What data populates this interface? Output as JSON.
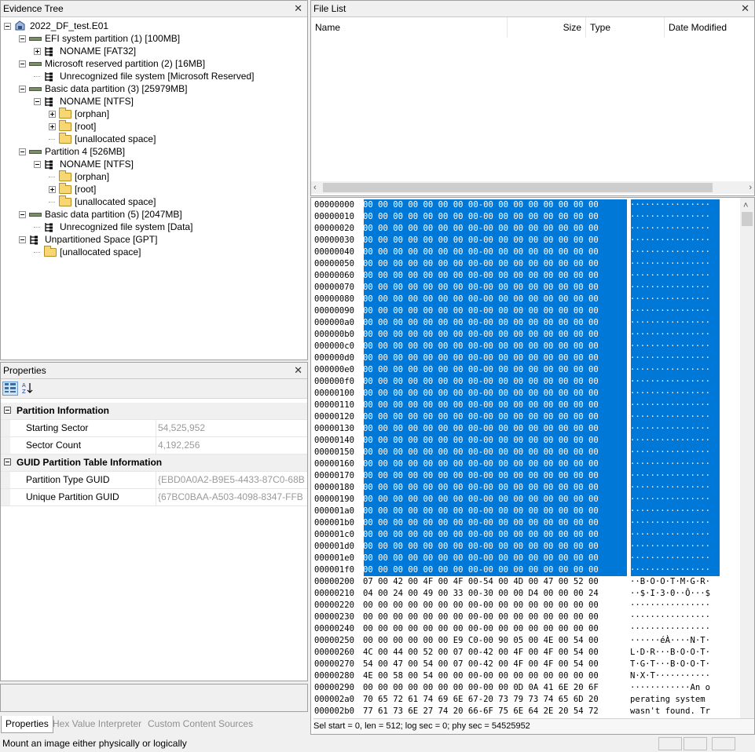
{
  "evidence_tree": {
    "title": "Evidence Tree",
    "nodes": [
      {
        "label": "2022_DF_test.E01"
      },
      {
        "label": "EFI system partition (1) [100MB]"
      },
      {
        "label": "NONAME [FAT32]"
      },
      {
        "label": "Microsoft reserved partition (2) [16MB]"
      },
      {
        "label": "Unrecognized file system [Microsoft Reserved]"
      },
      {
        "label": "Basic data partition (3) [25979MB]"
      },
      {
        "label": "NONAME [NTFS]"
      },
      {
        "label": "[orphan]"
      },
      {
        "label": "[root]"
      },
      {
        "label": "[unallocated space]"
      },
      {
        "label": "Partition 4 [526MB]"
      },
      {
        "label": "NONAME [NTFS]"
      },
      {
        "label": "[orphan]"
      },
      {
        "label": "[root]"
      },
      {
        "label": "[unallocated space]"
      },
      {
        "label": "Basic data partition (5) [2047MB]"
      },
      {
        "label": "Unrecognized file system [Data]"
      },
      {
        "label": "Unpartitioned Space [GPT]"
      },
      {
        "label": "[unallocated space]"
      }
    ]
  },
  "properties": {
    "title": "Properties",
    "cat1": "Partition Information",
    "rows1": [
      {
        "k": "Starting Sector",
        "v": "54,525,952"
      },
      {
        "k": "Sector Count",
        "v": "4,192,256"
      }
    ],
    "cat2": "GUID Partition Table Information",
    "rows2": [
      {
        "k": "Partition Type GUID",
        "v": "{EBD0A0A2-B9E5-4433-87C0-68B"
      },
      {
        "k": "Unique Partition GUID",
        "v": "{67BC0BAA-A503-4098-8347-FFB"
      }
    ]
  },
  "tabs": {
    "t1": "Properties",
    "t2": "Hex Value Interpreter",
    "t3": "Custom Content Sources"
  },
  "file_list": {
    "title": "File List",
    "cols": {
      "name": "Name",
      "size": "Size",
      "type": "Type",
      "date": "Date Modified"
    }
  },
  "hex": {
    "zero_bytes": "00 00 00 00 00 00 00 00-00 00 00 00 00 00 00 00",
    "zero_ascii": "················",
    "offsets": [
      "00000000",
      "00000010",
      "00000020",
      "00000030",
      "00000040",
      "00000050",
      "00000060",
      "00000070",
      "00000080",
      "00000090",
      "000000a0",
      "000000b0",
      "000000c0",
      "000000d0",
      "000000e0",
      "000000f0",
      "00000100",
      "00000110",
      "00000120",
      "00000130",
      "00000140",
      "00000150",
      "00000160",
      "00000170",
      "00000180",
      "00000190",
      "000001a0",
      "000001b0",
      "000001c0",
      "000001d0",
      "000001e0",
      "000001f0"
    ],
    "tail": [
      {
        "o": "00000200",
        "b": "07 00 42 00 4F 00 4F 00-54 00 4D 00 47 00 52 00",
        "a": "··B·O·O·T·M·G·R·"
      },
      {
        "o": "00000210",
        "b": "04 00 24 00 49 00 33 00-30 00 00 D4 00 00 00 24",
        "a": "··$·I·3·0··Ô···$"
      },
      {
        "o": "00000220",
        "b": "00 00 00 00 00 00 00 00-00 00 00 00 00 00 00 00",
        "a": "················"
      },
      {
        "o": "00000230",
        "b": "00 00 00 00 00 00 00 00-00 00 00 00 00 00 00 00",
        "a": "················"
      },
      {
        "o": "00000240",
        "b": "00 00 00 00 00 00 00 00-00 00 00 00 00 00 00 00",
        "a": "················"
      },
      {
        "o": "00000250",
        "b": "00 00 00 00 00 00 E9 C0-00 90 05 00 4E 00 54 00",
        "a": "······éÀ····N·T·"
      },
      {
        "o": "00000260",
        "b": "4C 00 44 00 52 00 07 00-42 00 4F 00 4F 00 54 00",
        "a": "L·D·R···B·O·O·T·"
      },
      {
        "o": "00000270",
        "b": "54 00 47 00 54 00 07 00-42 00 4F 00 4F 00 54 00",
        "a": "T·G·T···B·O·O·T·"
      },
      {
        "o": "00000280",
        "b": "4E 00 58 00 54 00 00 00-00 00 00 00 00 00 00 00",
        "a": "N·X·T···········"
      },
      {
        "o": "00000290",
        "b": "00 00 00 00 00 00 00 00-00 00 0D 0A 41 6E 20 6F",
        "a": "············An o"
      },
      {
        "o": "000002a0",
        "b": "70 65 72 61 74 69 6E 67-20 73 79 73 74 65 6D 20",
        "a": "perating system "
      },
      {
        "o": "000002b0",
        "b": "77 61 73 6E 27 74 20 66-6F 75 6E 64 2E 20 54 72",
        "a": "wasn't found. Tr"
      }
    ],
    "status": "Sel start = 0, len = 512; log sec = 0; phy sec = 54525952"
  },
  "status_bar": "Mount an image either physically or logically"
}
